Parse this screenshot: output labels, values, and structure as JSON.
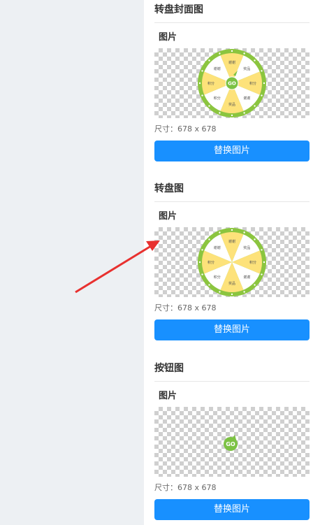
{
  "sections": [
    {
      "title": "转盘封面图",
      "label": "图片",
      "size_text": "尺寸：678 x 678",
      "button_label": "替换图片",
      "wheel_segments": [
        "谢谢",
        "奖品",
        "积分",
        "谢谢",
        "奖品",
        "积分",
        "积分",
        "谢谢"
      ],
      "center_label": "GO"
    },
    {
      "title": "转盘图",
      "label": "图片",
      "size_text": "尺寸：678 x 678",
      "button_label": "替换图片",
      "wheel_segments": [
        "谢谢",
        "奖品",
        "积分",
        "谢谢",
        "奖品",
        "积分",
        "积分",
        "谢谢"
      ]
    },
    {
      "title": "按钮图",
      "label": "图片",
      "size_text": "尺寸：678 x 678",
      "button_label": "替换图片",
      "center_label": "GO"
    }
  ],
  "colors": {
    "primary_button": "#1890ff",
    "wheel_rim": "#8bc53f",
    "segment_yellow": "#fde27a",
    "segment_white": "#ffffff",
    "go_button": "#7cc243",
    "annotation_arrow": "#e8312f"
  }
}
